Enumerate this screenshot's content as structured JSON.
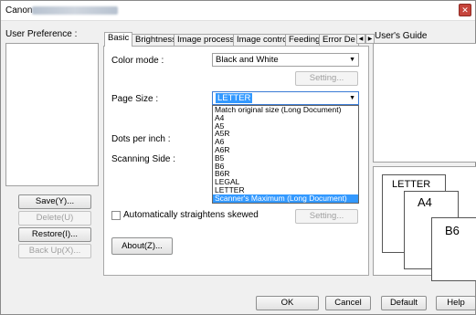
{
  "window": {
    "title": "Canon",
    "close_glyph": "✕"
  },
  "user_preference": {
    "label": "User Preference :",
    "buttons": {
      "save": "Save(Y)...",
      "delete": "Delete(U)",
      "restore": "Restore(I)...",
      "backup": "Back Up(X)..."
    }
  },
  "tabs": [
    "Basic",
    "Brightness",
    "Image processing",
    "Image control",
    "Feeding",
    "Error De"
  ],
  "basic": {
    "color_mode_label": "Color mode :",
    "color_mode_value": "Black and White",
    "setting_label": "Setting...",
    "page_size_label": "Page Size :",
    "page_size_value": "LETTER",
    "dpi_label": "Dots per inch :",
    "scanning_side_label": "Scanning Side :",
    "auto_straighten_label": "Automatically straightens skewed",
    "setting2_label": "Setting...",
    "about_label": "About(Z)..."
  },
  "page_size_options": [
    "Match original size (Long Document)",
    "A4",
    "A5",
    "A5R",
    "A6",
    "A6R",
    "B5",
    "B6",
    "B6R",
    "LEGAL",
    "LETTER",
    "Scanner's Maximum (Long Document)"
  ],
  "page_size_highlighted": "Scanner's Maximum (Long Document)",
  "user_guide": {
    "label": "User's Guide"
  },
  "preview": {
    "sheet1": "LETTER",
    "sheet2": "A4",
    "sheet3": "B6"
  },
  "footer": {
    "ok": "OK",
    "cancel": "Cancel",
    "default": "Default",
    "help": "Help"
  },
  "colors": {
    "highlight": "#3399ff",
    "close": "#c6443c"
  }
}
